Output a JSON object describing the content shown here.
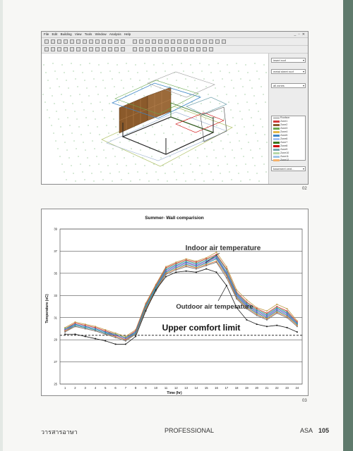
{
  "figure1": {
    "label": "02",
    "menu": [
      "File",
      "Edit",
      "Building",
      "View",
      "Tools",
      "Window",
      "Analysis",
      "Help"
    ],
    "side_fields": [
      "insert roof",
      "metal sheet roof",
      "all zones"
    ],
    "zones": [
      {
        "name": "Roofzon",
        "color": "#c9c9c9"
      },
      {
        "name": "Zone1",
        "color": "#d23a3a"
      },
      {
        "name": "Zone2",
        "color": "#8b5a2b"
      },
      {
        "name": "Zone3",
        "color": "#6aa84f"
      },
      {
        "name": "Zone4",
        "color": "#e6b84a"
      },
      {
        "name": "Zone5",
        "color": "#3d85c6"
      },
      {
        "name": "Zone6",
        "color": "#a4c2f4"
      },
      {
        "name": "Zone7",
        "color": "#38761d"
      },
      {
        "name": "Zone8",
        "color": "#cc0000"
      },
      {
        "name": "Zone9",
        "color": "#76a5af"
      },
      {
        "name": "Zone10",
        "color": "#b6d7a8"
      },
      {
        "name": "Zone11",
        "color": "#9fc5e8"
      },
      {
        "name": "Zone12",
        "color": "#f6b26b"
      }
    ],
    "bottom_field": "basement vent..."
  },
  "figure2": {
    "label": "03",
    "annotations": {
      "indoor": "Indoor air temperature",
      "outdoor": "Outdoor air temperature",
      "comfort": "Upper comfort limit"
    }
  },
  "chart_data": {
    "type": "line",
    "title": "Summer- Wall comparision",
    "xlabel": "Time (hr)",
    "ylabel": "Temperature (oC)",
    "x": [
      1,
      2,
      3,
      4,
      5,
      6,
      7,
      8,
      9,
      10,
      11,
      12,
      13,
      14,
      15,
      16,
      17,
      18,
      19,
      20,
      21,
      22,
      23,
      24
    ],
    "ylim": [
      25,
      39
    ],
    "yticks": [
      25,
      27,
      29,
      31,
      33,
      35,
      37,
      39
    ],
    "grid": true,
    "legend": "none",
    "comfort_limit": 29.4,
    "series": [
      {
        "color": "#c4a050",
        "values": [
          30.1,
          30.6,
          30.4,
          30.2,
          29.9,
          29.6,
          29.3,
          29.9,
          32.3,
          34.0,
          35.6,
          36.0,
          36.3,
          36.1,
          36.4,
          36.9,
          35.6,
          33.5,
          32.6,
          31.9,
          31.6,
          32.2,
          31.8,
          30.7
        ]
      },
      {
        "color": "#d24040",
        "values": [
          30.0,
          30.5,
          30.3,
          30.1,
          29.8,
          29.5,
          29.2,
          29.8,
          32.2,
          33.9,
          35.5,
          35.9,
          36.2,
          36.0,
          36.3,
          36.7,
          35.4,
          33.3,
          32.4,
          31.8,
          31.4,
          32.0,
          31.6,
          30.6
        ]
      },
      {
        "color": "#4caf8a",
        "values": [
          30.0,
          30.4,
          30.2,
          30.0,
          29.7,
          29.5,
          29.2,
          29.7,
          32.1,
          33.8,
          35.4,
          35.8,
          36.1,
          35.9,
          36.2,
          36.6,
          35.3,
          33.2,
          32.3,
          31.7,
          31.3,
          31.9,
          31.5,
          30.5
        ]
      },
      {
        "color": "#3f78c8",
        "values": [
          29.9,
          30.4,
          30.2,
          30.0,
          29.7,
          29.4,
          29.1,
          29.7,
          32.0,
          33.7,
          35.3,
          35.7,
          36.0,
          35.8,
          36.1,
          36.5,
          35.1,
          33.1,
          32.2,
          31.6,
          31.2,
          31.8,
          31.4,
          30.5
        ]
      },
      {
        "color": "#8a5cc2",
        "values": [
          29.9,
          30.3,
          30.1,
          29.9,
          29.6,
          29.4,
          29.1,
          29.6,
          31.9,
          33.6,
          35.2,
          35.6,
          35.9,
          35.7,
          36.0,
          36.4,
          35.0,
          33.0,
          32.1,
          31.5,
          31.1,
          31.7,
          31.3,
          30.4
        ]
      },
      {
        "color": "#2e9ea0",
        "values": [
          29.8,
          30.3,
          30.1,
          29.9,
          29.6,
          29.3,
          29.0,
          29.6,
          31.9,
          33.6,
          35.1,
          35.5,
          35.8,
          35.6,
          35.9,
          36.3,
          34.9,
          32.9,
          32.0,
          31.4,
          31.0,
          31.6,
          31.2,
          30.4
        ]
      },
      {
        "color": "#e07b39",
        "values": [
          29.8,
          30.2,
          30.0,
          29.8,
          29.5,
          29.3,
          29.0,
          29.5,
          31.8,
          33.5,
          35.0,
          35.4,
          35.7,
          35.5,
          35.8,
          36.1,
          34.8,
          32.8,
          31.9,
          31.3,
          30.9,
          31.5,
          31.1,
          30.3
        ]
      },
      {
        "color": "#7a7a7a",
        "values": [
          29.7,
          30.2,
          30.0,
          29.8,
          29.5,
          29.2,
          28.9,
          29.5,
          31.7,
          33.4,
          34.9,
          35.3,
          35.6,
          35.4,
          35.7,
          36.0,
          34.6,
          32.7,
          31.8,
          31.2,
          30.8,
          31.4,
          31.0,
          30.2
        ]
      },
      {
        "color": "#1a1a1a",
        "values": [
          29.5,
          29.5,
          29.3,
          29.1,
          28.9,
          28.6,
          28.6,
          29.3,
          31.6,
          33.5,
          34.7,
          35.1,
          35.2,
          35.1,
          35.4,
          35.1,
          33.9,
          31.9,
          30.8,
          30.4,
          30.2,
          30.3,
          30.1,
          29.7
        ]
      }
    ]
  },
  "footer": {
    "journal": "วารสารอาษา",
    "section": "PROFESSIONAL",
    "brand": "ASA",
    "page": "105"
  }
}
